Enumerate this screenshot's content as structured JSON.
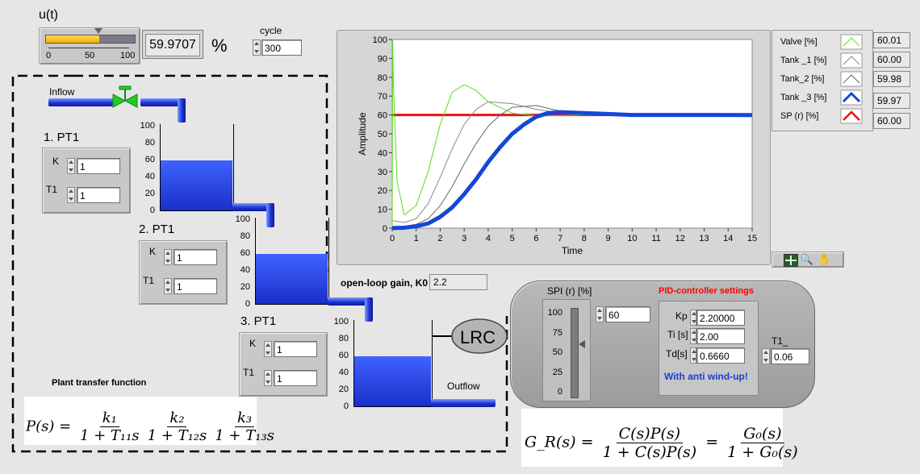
{
  "control": {
    "title": "u(t)",
    "slider_ticks": [
      "0",
      "50",
      "100"
    ],
    "slider_level_percent": 60,
    "value": "59.9707",
    "unit": "%"
  },
  "cycle": {
    "label": "cycle",
    "value": "300"
  },
  "plant": {
    "inflow_label": "Inflow",
    "outflow_label": "Outflow",
    "tank_ticks": [
      "100",
      "80",
      "60",
      "40",
      "20",
      "0"
    ],
    "tanks": [
      {
        "title": "1. PT1",
        "k_label": "K",
        "k_value": "1",
        "t_label": "T1",
        "t_value": "1",
        "level_percent": 60
      },
      {
        "title": "2. PT1",
        "k_label": "K",
        "k_value": "1",
        "t_label": "T1",
        "t_value": "1",
        "level_percent": 60
      },
      {
        "title": "3. PT1",
        "k_label": "K",
        "k_value": "1",
        "t_label": "T1",
        "t_value": "1",
        "level_percent": 60
      }
    ],
    "lrc_label": "LRC",
    "transfer_title": "Plant transfer function"
  },
  "open_loop": {
    "label": "open-loop gain, K0",
    "value": "2.2"
  },
  "pid": {
    "sp_label": "SPI (r) [%]",
    "sp_ticks": [
      "100",
      "75",
      "50",
      "25",
      "0"
    ],
    "sp_value": "60",
    "title": "PID-controller settings",
    "kp_label": "Kp",
    "kp_value": "2.20000",
    "ti_label": "Ti [s]",
    "ti_value": "2.00",
    "td_label": "Td[s]",
    "td_value": "0.6660",
    "antiwindup": "With anti wind-up!",
    "t1_label": "T1_",
    "t1_value": "0.06",
    "colors": {
      "title": "#ff0000",
      "antiwindup": "#1a3fd0"
    }
  },
  "legend": [
    {
      "name": "Valve [%]",
      "value": "60.01",
      "color": "#55dd22"
    },
    {
      "name": "Tank _1 [%]",
      "value": "60.00",
      "color": "#888888"
    },
    {
      "name": "Tank_2 [%]",
      "value": "59.98",
      "color": "#666666"
    },
    {
      "name": "Tank _3 [%]",
      "value": "59.97",
      "color": "#1446d8"
    },
    {
      "name": "SP (r) [%]",
      "value": "60.00",
      "color": "#ee1111"
    }
  ],
  "chart_data": {
    "type": "line",
    "xlabel": "Time",
    "ylabel": "Amplitude",
    "xlim": [
      0,
      15
    ],
    "ylim": [
      0,
      100
    ],
    "x_ticks": [
      0,
      1,
      2,
      3,
      4,
      5,
      6,
      7,
      8,
      9,
      10,
      11,
      12,
      13,
      14,
      15
    ],
    "y_ticks": [
      0,
      10,
      20,
      30,
      40,
      50,
      60,
      70,
      80,
      90,
      100
    ],
    "grid": false,
    "series": [
      {
        "name": "Valve [%]",
        "x": [
          0,
          0.02,
          0.05,
          0.2,
          0.5,
          1,
          1.5,
          2,
          2.5,
          3,
          3.5,
          4,
          5,
          6,
          7,
          8,
          9,
          10,
          12,
          15
        ],
        "y": [
          0,
          100,
          76,
          25,
          7,
          12,
          30,
          55,
          72,
          76,
          73,
          67,
          61,
          59.5,
          59.6,
          60,
          60,
          60,
          60,
          60.01
        ]
      },
      {
        "name": "Tank _1 [%]",
        "x": [
          0,
          0.5,
          1,
          1.5,
          2,
          2.5,
          3,
          3.5,
          4,
          5,
          6,
          7,
          8,
          9,
          10,
          12,
          15
        ],
        "y": [
          4,
          3,
          5,
          13,
          27,
          42,
          55,
          63,
          67,
          66,
          63,
          61,
          60,
          60,
          60,
          60,
          60
        ]
      },
      {
        "name": "Tank_2 [%]",
        "x": [
          0,
          0.5,
          1,
          1.5,
          2,
          2.5,
          3,
          3.5,
          4,
          4.5,
          5,
          6,
          7,
          8,
          9,
          10,
          12,
          15
        ],
        "y": [
          1,
          1,
          2,
          5,
          12,
          22,
          34,
          45,
          54,
          60,
          64,
          65,
          62,
          60.5,
          60,
          60,
          60,
          59.98
        ]
      },
      {
        "name": "Tank _3 [%]",
        "x": [
          0,
          0.5,
          1,
          1.5,
          2,
          2.5,
          3,
          3.5,
          4,
          4.5,
          5,
          5.5,
          6,
          6.5,
          7,
          8,
          9,
          10,
          12,
          15
        ],
        "y": [
          0,
          0.2,
          1,
          2.5,
          6,
          11,
          18,
          26,
          35,
          43,
          50,
          55,
          59,
          61,
          61.5,
          61,
          60.5,
          60,
          60,
          59.97
        ]
      },
      {
        "name": "SP (r) [%]",
        "x": [
          0,
          15
        ],
        "y": [
          60,
          60
        ]
      }
    ]
  },
  "formulas": {
    "plant_lhs": "P(s) =",
    "plant_terms": [
      {
        "num": "k₁",
        "den": "1 + T₁₁s"
      },
      {
        "num": "k₂",
        "den": "1 + T₁₂s"
      },
      {
        "num": "k₃",
        "den": "1 + T₁₃s"
      }
    ],
    "closed_lhs": "G_R(s) =",
    "closed_num1": "C(s)P(s)",
    "closed_den1": "1 + C(s)P(s)",
    "closed_eq": "=",
    "closed_num2": "G₀(s)",
    "closed_den2": "1 + G₀(s)"
  }
}
